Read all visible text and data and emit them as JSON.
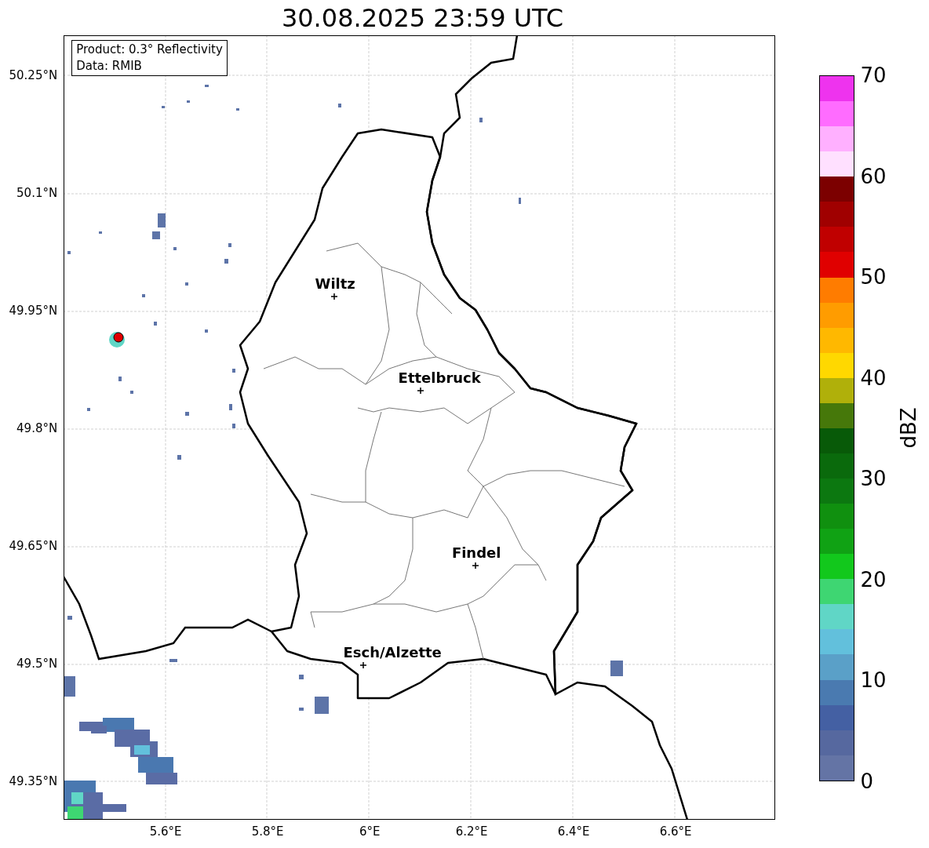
{
  "title": "30.08.2025 23:59 UTC",
  "info_box": [
    "Product: 0.3° Reflectivity",
    "Data: RMIB"
  ],
  "yticks": [
    "50.25°N",
    "50.1°N",
    "49.95°N",
    "49.8°N",
    "49.65°N",
    "49.5°N",
    "49.35°N"
  ],
  "xticks": [
    "5.6°E",
    "5.8°E",
    "6°E",
    "6.2°E",
    "6.4°E",
    "6.6°E"
  ],
  "cities": [
    {
      "name": "Wiltz"
    },
    {
      "name": "Ettelbruck"
    },
    {
      "name": "Findel"
    },
    {
      "name": "Esch/Alzette"
    }
  ],
  "colorbar": {
    "label": "dBZ",
    "ticks": [
      "70",
      "60",
      "50",
      "40",
      "30",
      "20",
      "10",
      "0"
    ],
    "bands": [
      {
        "color": "#ee33ee"
      },
      {
        "color": "#ff6cff"
      },
      {
        "color": "#ffb0ff"
      },
      {
        "color": "#ffe0ff"
      },
      {
        "color": "#7c0000"
      },
      {
        "color": "#a00000"
      },
      {
        "color": "#c00000"
      },
      {
        "color": "#e00000"
      },
      {
        "color": "#ff7c00"
      },
      {
        "color": "#ff9c00"
      },
      {
        "color": "#ffb800"
      },
      {
        "color": "#ffd800"
      },
      {
        "color": "#b0b00a"
      },
      {
        "color": "#46780a"
      },
      {
        "color": "#085a08"
      },
      {
        "color": "#0a6a0c"
      },
      {
        "color": "#0c7810"
      },
      {
        "color": "#10900f"
      },
      {
        "color": "#10a214"
      },
      {
        "color": "#12c81c"
      },
      {
        "color": "#3ed672"
      },
      {
        "color": "#60d6c6"
      },
      {
        "color": "#62c0dc"
      },
      {
        "color": "#5aa0c8"
      },
      {
        "color": "#4a7ab0"
      },
      {
        "color": "#4460a3"
      },
      {
        "color": "#56689f"
      },
      {
        "color": "#6474a5"
      }
    ]
  }
}
